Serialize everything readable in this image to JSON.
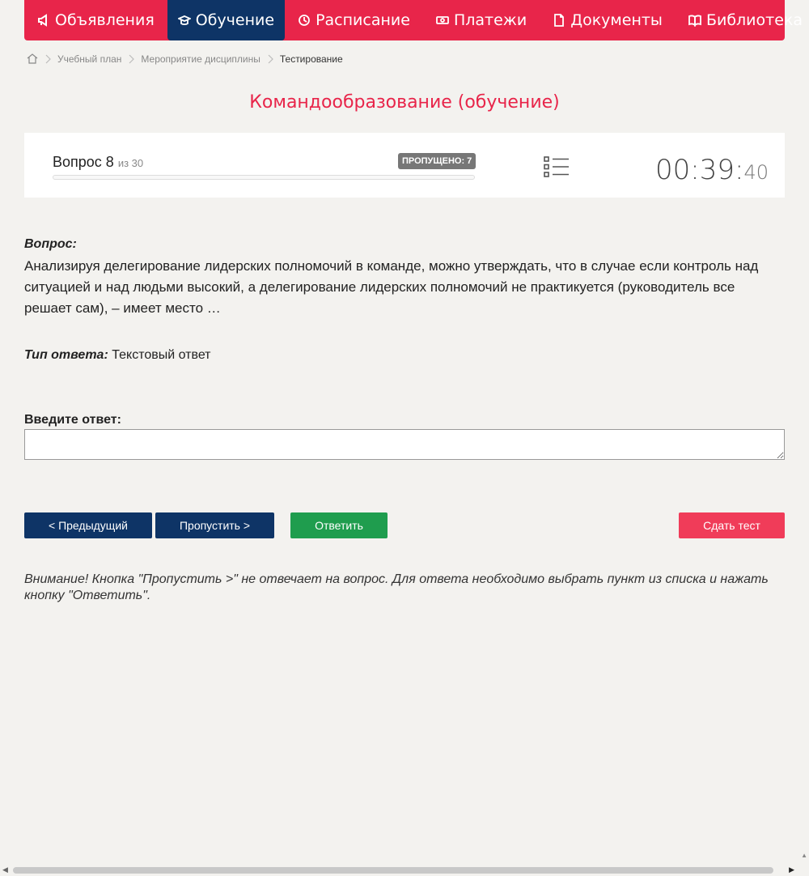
{
  "nav": {
    "announcements": "Объявления",
    "education": "Обучение",
    "schedule": "Расписание",
    "payments": "Платежи",
    "documents": "Документы",
    "library": "Библиотека"
  },
  "breadcrumb": {
    "curriculum": "Учебный план",
    "discipline_event": "Мероприятие дисциплины",
    "testing": "Тестирование"
  },
  "page_title": "Командообразование (обучение)",
  "progress": {
    "question_label": "Вопрос 8",
    "of_total": "из 30",
    "skipped": "ПРОПУЩЕНО: 7",
    "fraction_complete": 0.0
  },
  "timer": {
    "hours_minutes": "00:39:",
    "seconds": "40"
  },
  "question": {
    "heading": "Вопрос:",
    "text": "Анализируя делегирование лидерских полномочий в команде, можно утверждать, что в случае если контроль над ситуацией и над людьми высокий, а делегирование лидерских полномочий не практикуется (руководитель все решает сам), – имеет место …"
  },
  "answer_type": {
    "label": "Тип ответа:",
    "value": "Текстовый ответ"
  },
  "answer": {
    "label": "Введите ответ:",
    "value": "",
    "placeholder": ""
  },
  "buttons": {
    "prev": "< Предыдущий",
    "skip": "Пропустить >",
    "answer": "Ответить",
    "submit": "Сдать тест"
  },
  "notice": "Внимание! Кнопка \"Пропустить >\" не отвечает на вопрос. Для ответа необходимо выбрать пункт из списка и нажать кнопку \"Ответить\".",
  "colors": {
    "brand": "#e8254a",
    "nav_active": "#0e3466",
    "answer_button": "#1f9d4e",
    "submit_button": "#f03c59"
  }
}
